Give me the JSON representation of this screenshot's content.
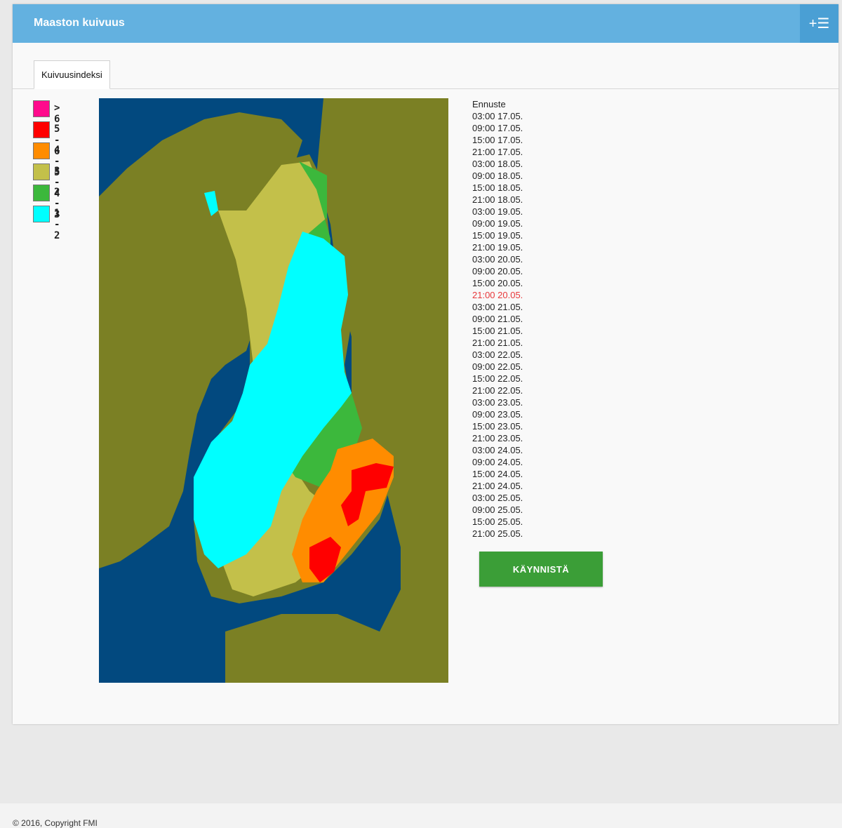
{
  "header": {
    "title": "Maaston kuivuus",
    "menu_icon": "add-list-icon",
    "menu_label": "+☰"
  },
  "tabs": [
    {
      "label": "Kuivuusindeksi",
      "active": true
    }
  ],
  "legend": [
    {
      "label": "> 6",
      "color": "#ff0a8c"
    },
    {
      "label": "5 - 6",
      "color": "#ff0000"
    },
    {
      "label": "4 - 5",
      "color": "#ff8c00"
    },
    {
      "label": "3 - 4",
      "color": "#c3c04a"
    },
    {
      "label": "2 - 3",
      "color": "#3cb83c"
    },
    {
      "label": "1 - 2",
      "color": "#00ffff"
    }
  ],
  "map_colors": {
    "sea": "#02497f",
    "land": "#7b8024",
    "index_1_2": "#00ffff",
    "index_2_3": "#3cb83c",
    "index_3_4": "#c3c04a",
    "index_4_5": "#ff8c00",
    "index_5_6": "#ff0000"
  },
  "forecast": {
    "heading": "Ennuste",
    "items": [
      "03:00 17.05.",
      "09:00 17.05.",
      "15:00 17.05.",
      "21:00 17.05.",
      "03:00 18.05.",
      "09:00 18.05.",
      "15:00 18.05.",
      "21:00 18.05.",
      "03:00 19.05.",
      "09:00 19.05.",
      "15:00 19.05.",
      "21:00 19.05.",
      "03:00 20.05.",
      "09:00 20.05.",
      "15:00 20.05.",
      "21:00 20.05.",
      "03:00 21.05.",
      "09:00 21.05.",
      "15:00 21.05.",
      "21:00 21.05.",
      "03:00 22.05.",
      "09:00 22.05.",
      "15:00 22.05.",
      "21:00 22.05.",
      "03:00 23.05.",
      "09:00 23.05.",
      "15:00 23.05.",
      "21:00 23.05.",
      "03:00 24.05.",
      "09:00 24.05.",
      "15:00 24.05.",
      "21:00 24.05.",
      "03:00 25.05.",
      "09:00 25.05.",
      "15:00 25.05.",
      "21:00 25.05."
    ],
    "active_item": "21:00 20.05.",
    "active_color": "#e8383b"
  },
  "start_button": {
    "label": "KÄYNNISTÄ"
  },
  "footer": {
    "text": "© 2016, Copyright FMI"
  }
}
